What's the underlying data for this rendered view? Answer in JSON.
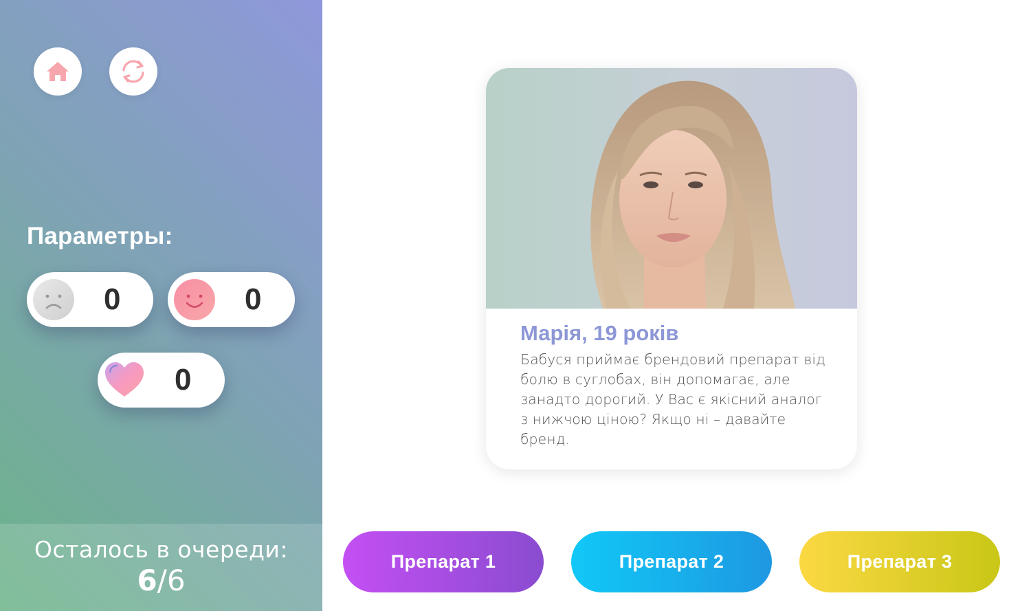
{
  "sidebar": {
    "home_icon": "home-icon",
    "restart_icon": "restart-icon",
    "params_title": "Параметры:",
    "stats": [
      {
        "icon": "sad-face-icon",
        "value": "0"
      },
      {
        "icon": "happy-face-icon",
        "value": "0"
      },
      {
        "icon": "heart-icon",
        "value": "0"
      }
    ],
    "queue_label": "Осталось в очереди:",
    "queue_current": "6",
    "queue_separator": "/",
    "queue_total": "6"
  },
  "card": {
    "name": "Марія, 19 років",
    "text": "Бабуся приймає брендовий препарат від болю в суглобах, він допомагає, але занадто дорогий. У Вас є якісний аналог з нижчою ціною? Якщо ні – давайте бренд."
  },
  "answers": [
    {
      "label": "Препарат 1"
    },
    {
      "label": "Препарат 2"
    },
    {
      "label": "Препарат 3"
    }
  ],
  "colors": {
    "accent_pink": "#f7a6ae",
    "name_color": "#8d97d6",
    "button_1": "#b04ee8",
    "button_2": "#17b3f0",
    "button_3": "#e6d02c"
  }
}
